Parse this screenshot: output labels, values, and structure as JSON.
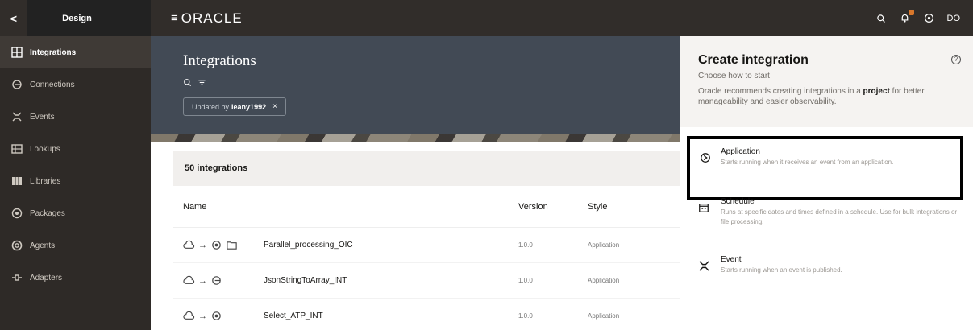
{
  "sidebar": {
    "back": "<",
    "title": "Design",
    "items": [
      {
        "label": "Integrations",
        "icon": "integrations-icon",
        "active": true
      },
      {
        "label": "Connections",
        "icon": "connections-icon"
      },
      {
        "label": "Events",
        "icon": "events-icon"
      },
      {
        "label": "Lookups",
        "icon": "lookups-icon"
      },
      {
        "label": "Libraries",
        "icon": "libraries-icon"
      },
      {
        "label": "Packages",
        "icon": "packages-icon"
      },
      {
        "label": "Agents",
        "icon": "agents-icon"
      },
      {
        "label": "Adapters",
        "icon": "adapters-icon"
      }
    ]
  },
  "topbar": {
    "menu": "≡",
    "logo": "ORACLE",
    "user": "DO"
  },
  "main": {
    "title": "Integrations",
    "filter": {
      "prefix": "Updated by",
      "value": "leany1992",
      "remove": "×"
    },
    "count_label": "50 integrations",
    "columns": {
      "name": "Name",
      "version": "Version",
      "style": "Style"
    },
    "rows": [
      {
        "name": "Parallel_processing_OIC",
        "version": "1.0.0",
        "style": "Application"
      },
      {
        "name": "JsonStringToArray_INT",
        "version": "1.0.0",
        "style": "Application"
      },
      {
        "name": "Select_ATP_INT",
        "version": "1.0.0",
        "style": "Application"
      }
    ]
  },
  "panel": {
    "title": "Create integration",
    "subtitle": "Choose how to start",
    "note_pre": "Oracle recommends creating integrations in a",
    "note_bold": "project",
    "note_post": "for better manageability and easier observability.",
    "options": {
      "application": {
        "title": "Application",
        "desc": "Starts running when it receives an event from an application."
      },
      "schedule": {
        "title": "Schedule",
        "desc": "Runs at specific dates and times defined in a schedule. Use for bulk integrations or file processing."
      },
      "event": {
        "title": "Event",
        "desc": "Starts running when an event is published."
      }
    }
  },
  "colors": {
    "sidebar_bg": "#2e2a27",
    "topbar_bg": "#312d2a",
    "header_bg": "#424a55",
    "highlight_border": "#000000"
  }
}
